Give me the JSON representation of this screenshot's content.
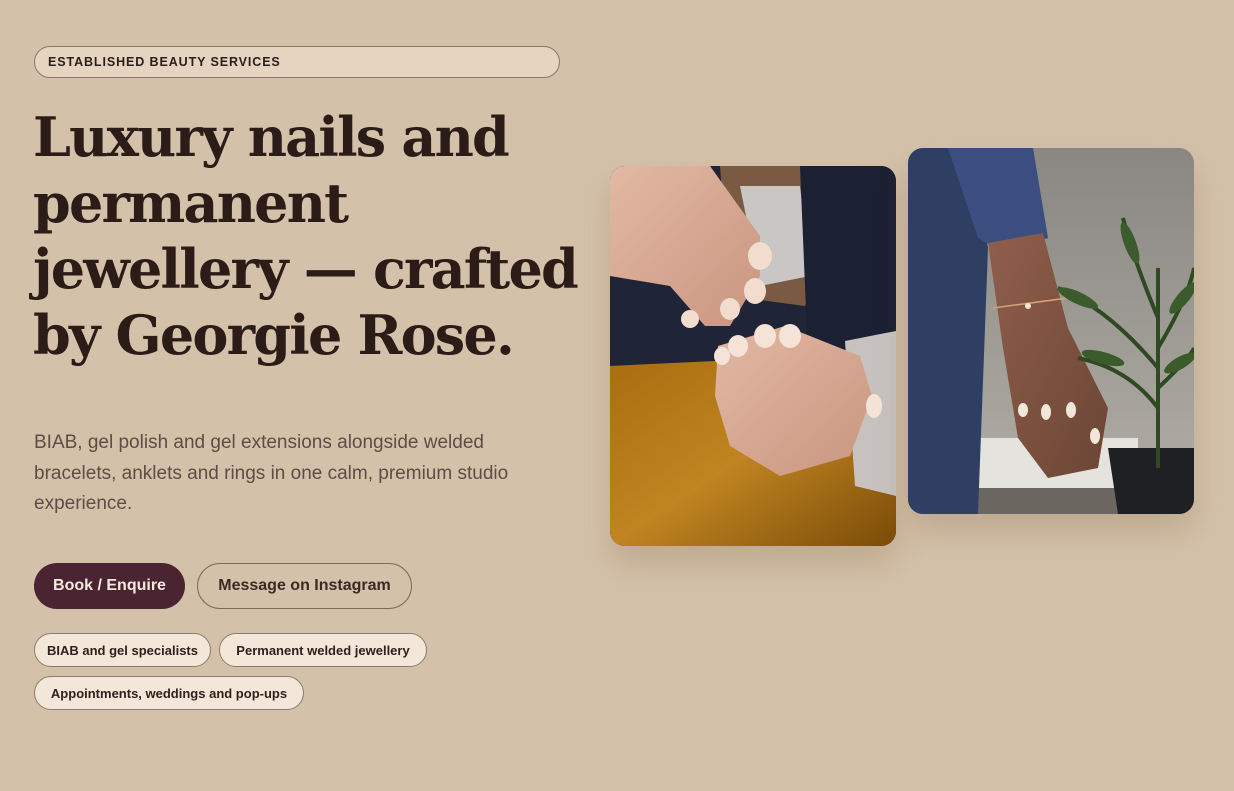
{
  "hero": {
    "eyebrow": "ESTABLISHED BEAUTY SERVICES",
    "headline": "Luxury nails and permanent jewellery — crafted by Georgie Rose.",
    "subtext": "BIAB, gel polish and gel extensions alongside welded bracelets, anklets and rings in one calm, premium studio experience.",
    "primary_cta": "Book / Enquire",
    "secondary_cta": "Message on Instagram",
    "tags": [
      "BIAB and gel specialists",
      "Permanent welded jewellery",
      "Appointments, weddings and pop-ups"
    ]
  },
  "colors": {
    "background": "#d4c1a9",
    "primary_button": "#4a2531",
    "headline": "#2b1c18",
    "pill_background": "#f3e7da"
  }
}
